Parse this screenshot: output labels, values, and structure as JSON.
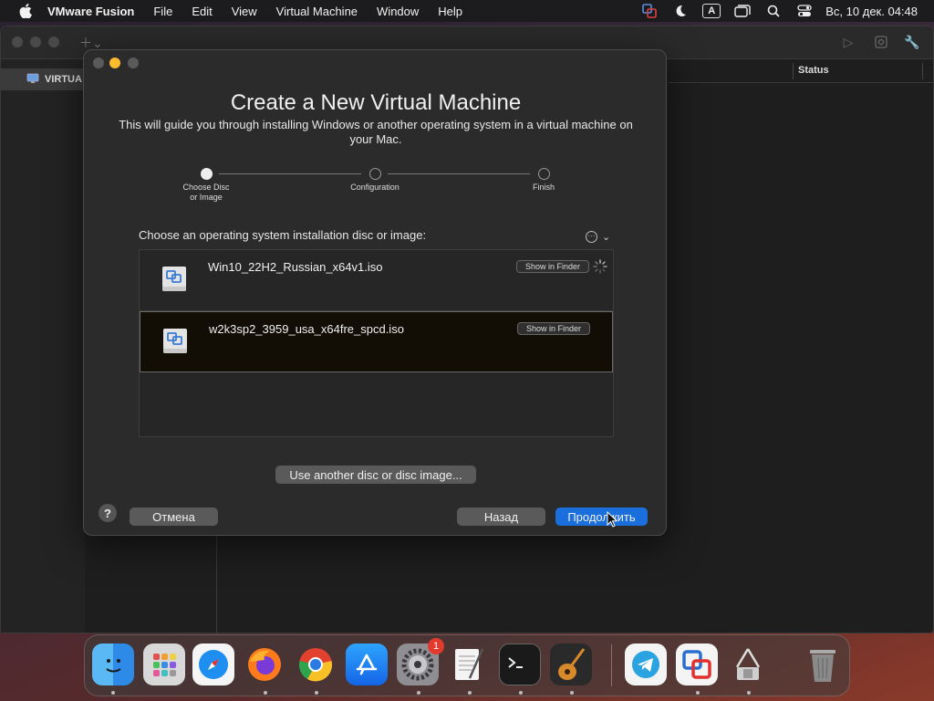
{
  "menubar": {
    "app_name": "VMware Fusion",
    "items": [
      "File",
      "Edit",
      "View",
      "Virtual Machine",
      "Window",
      "Help"
    ],
    "input_source_letter": "A",
    "clock": "Вс, 10 дек.  04:48"
  },
  "main_window": {
    "sidebar_item": "VIRTUA",
    "status_column": "Status"
  },
  "dialog": {
    "title": "Create a New Virtual Machine",
    "subtitle": "This will guide you through installing Windows or another operating system in a virtual machine on your Mac.",
    "steps": [
      {
        "line1": "Choose Disc",
        "line2": "or Image",
        "active": true
      },
      {
        "line1": "Configuration",
        "line2": "",
        "active": false
      },
      {
        "line1": "Finish",
        "line2": "",
        "active": false
      }
    ],
    "choose_label": "Choose an operating system installation disc or image:",
    "discs": [
      {
        "name": "Win10_22H2_Russian_x64v1.iso",
        "show_label": "Show in Finder",
        "loading": true
      },
      {
        "name": "w2k3sp2_3959_usa_x64fre_spcd.iso",
        "show_label": "Show in Finder",
        "selected": true
      }
    ],
    "another_disc_button": "Use another disc or disc image...",
    "help_symbol": "?",
    "cancel_button": "Отмена",
    "back_button": "Назад",
    "continue_button": "Продолжить"
  },
  "dock": {
    "apps": [
      "finder-icon",
      "launchpad-icon",
      "safari-icon",
      "firefox-icon",
      "chrome-icon",
      "app-store-icon",
      "system-settings-icon",
      "textedit-icon",
      "terminal-icon",
      "garageband-icon",
      "telegram-icon",
      "vmware-fusion-icon",
      "archive-utility-icon",
      "trash-icon"
    ],
    "settings_badge": "1"
  },
  "colors": {
    "accent": "#1a6fdc",
    "close": "#ff5f57",
    "minimize": "#febc2e",
    "badge": "#e23a2e"
  }
}
